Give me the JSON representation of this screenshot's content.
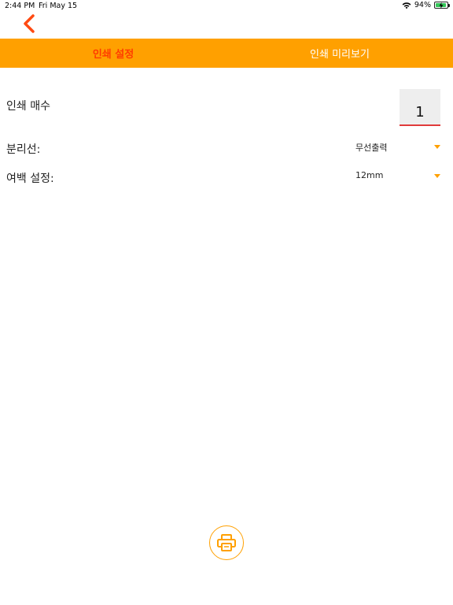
{
  "status_bar": {
    "time": "2:44 PM",
    "date": "Fri May 15",
    "battery_percent": "94%",
    "battery_level": 0.94,
    "wifi_icon": "wifi-icon",
    "battery_charging": true
  },
  "nav": {
    "back_icon": "chevron-left-icon"
  },
  "tabs": [
    {
      "label": "인쇄 설정",
      "active": true
    },
    {
      "label": "인쇄 미리보기",
      "active": false
    }
  ],
  "settings": {
    "copies_label": "인쇄 매수",
    "copies_value": "1",
    "separator_label": "분리선:",
    "separator_value": "무선출력",
    "margin_label": "여백 설정:",
    "margin_value": "12mm"
  },
  "print_button_icon": "printer-icon",
  "colors": {
    "accent": "#ffa000",
    "active_tab": "#ff3c00",
    "back_arrow": "#ff4a12",
    "input_underline": "#e03a3a"
  }
}
